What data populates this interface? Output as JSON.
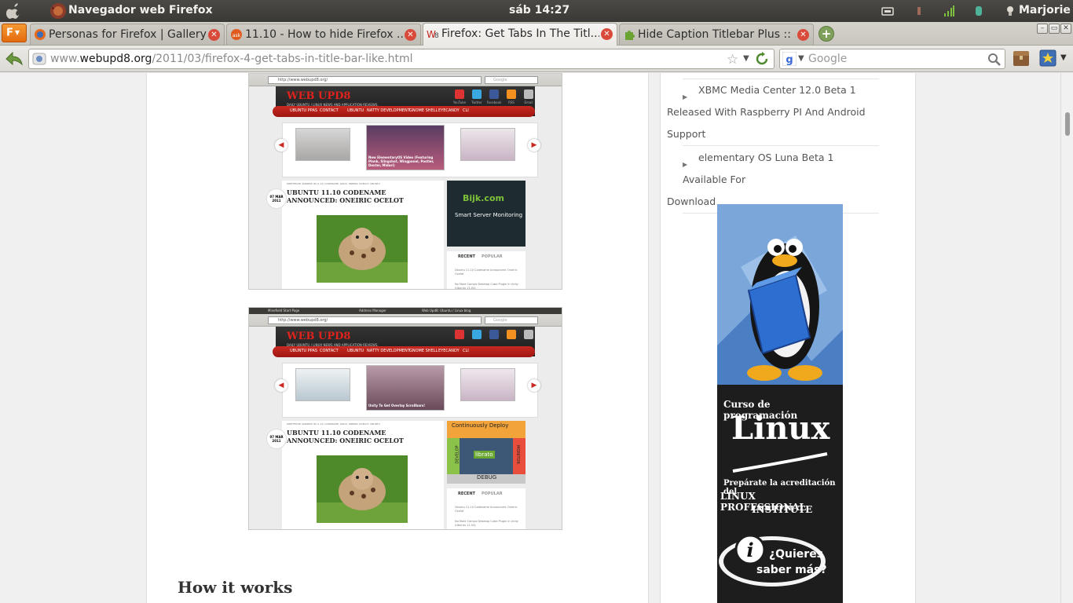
{
  "system_panel": {
    "app_title": "Navegador web Firefox",
    "clock": "sáb 14:27",
    "user": "Marjorie"
  },
  "firefox_menu": {
    "label": "F"
  },
  "tabs": [
    {
      "label": "Personas for Firefox | Gallery",
      "favicon": "firefox-icon",
      "active": false
    },
    {
      "label": "11.10 - How to hide Firefox ...",
      "favicon": "askubuntu-icon",
      "active": false
    },
    {
      "label": "Firefox: Get Tabs In The Titl...",
      "favicon": "webupd8-icon",
      "active": true
    },
    {
      "label": "Hide Caption Titlebar Plus :: ...",
      "favicon": "puzzle-icon",
      "active": false
    }
  ],
  "address_bar": {
    "prefix": "www.",
    "domain": "webupd8.org",
    "path": "/2011/03/firefox-4-get-tabs-in-title-bar-like.html"
  },
  "search_bar": {
    "placeholder": "Google"
  },
  "embedded_shot": {
    "url": "http://www.webupd8.org/",
    "search_placeholder": "Google",
    "logo": "WEB UPD8",
    "tagline": "DAILY UBUNTU / LINUX NEWS AND APPLICATION REVIEWS.",
    "social": [
      "YouTube",
      "Twitter",
      "Facebook",
      "RSS",
      "Email"
    ],
    "menu": [
      "UBUNTU PPAS",
      "CONTACT",
      "UBUNTU",
      "NATTY DEVELOPMENT",
      "GNOME SHELL",
      "EYECANDY",
      "CLI"
    ],
    "date_month": "07 MAR",
    "date_year": "2011",
    "meta": "WRITTEN BY ANDREW IN 11.10, CODENAME, LINUX, ONEIRIC OCELOT, UBUNTU",
    "headline": "UBUNTU 11.10 CODENAME ANNOUNCED: ONEIRIC OCELOT",
    "recent_tab": "RECENT",
    "popular_tab": "POPULAR",
    "recent_items": [
      "Ubuntu 11.10 Codename Announced: Oneiric Ocelot",
      "No More Compiz Desktop Cube Plugin In Unity (Ubuntu 11.04)"
    ],
    "first_slide_caption": "New ElementaryOS Video (Featuring Plank, Slingshot, Wingpanel, Postler, Dexter, Midori)",
    "second_slide_caption": "Unity To Get Overlay Scrollbars!",
    "first_ad_brand": "Bijk.com",
    "first_ad_text": "Smart Server Monitoring",
    "second_ad_top": "Continuously Deploy",
    "second_ad_left": "DEVELOP",
    "second_ad_right": "MONITOR",
    "second_ad_center": "librato",
    "second_ad_bottom": "DEBUG",
    "second_shot_tabs": [
      "Minefield Start Page",
      "Address Manager",
      "Web Upd8: Ubuntu / Linux blog"
    ]
  },
  "article": {
    "heading": "How it works"
  },
  "sidebar": {
    "items": [
      {
        "line1": "XBMC Media Center 12.0 Beta 1",
        "line2": "Released With Raspberry PI And Android",
        "line3": "Support"
      },
      {
        "line1": "elementary OS Luna Beta 1 Available For",
        "line2": "Download"
      }
    ]
  },
  "linux_ad": {
    "line1": "Curso de programación",
    "brand": "Linux",
    "line2": "Prepárate la acreditación del",
    "line3": "LINUX PROFESSIONAL",
    "line4": "INSTITUTE",
    "cta1": "¿Quieres",
    "cta2": "saber más?"
  }
}
